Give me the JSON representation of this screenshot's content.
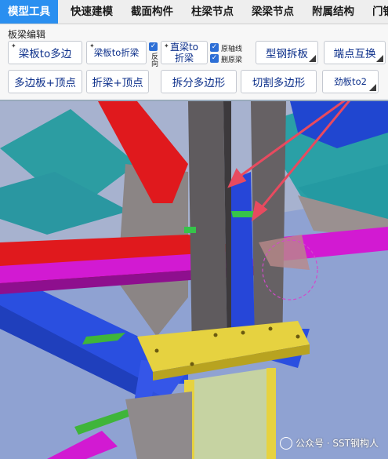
{
  "tabs": [
    {
      "label": "模型工具",
      "active": true
    },
    {
      "label": "快速建模",
      "active": false
    },
    {
      "label": "截面构件",
      "active": false
    },
    {
      "label": "柱梁节点",
      "active": false
    },
    {
      "label": "梁梁节点",
      "active": false
    },
    {
      "label": "附属结构",
      "active": false
    },
    {
      "label": "门钢",
      "active": false
    }
  ],
  "ribbon": {
    "group_label": "板梁编辑",
    "buttons": {
      "plate_to_polygon": "梁板to多边",
      "plate_to_folded": "梁板to折梁",
      "straight_line1": "直梁to",
      "straight_line2": "折梁",
      "section_steel_split": "型钢拆板",
      "end_swap": "端点互换",
      "polygon_vertex": "多边板+顶点",
      "folded_vertex": "折梁+顶点",
      "split_polygon": "拆分多边形",
      "cut_polygon": "切割多边形",
      "stiffener": "劲板to2"
    },
    "checkboxes": {
      "reverse": "反向",
      "original_axis": "原轴线",
      "delete_original": "删原梁"
    }
  },
  "watermark": "公众号 · SST钢构人",
  "colors": {
    "active_tab": "#2a8ff0",
    "button_text": "#0c2f8a",
    "red_beam": "#e0191d",
    "magenta_beam": "#d21ad2",
    "blue_beam": "#2a4fe0",
    "teal_plate": "#2a9ca0",
    "arrow": "#e84a5f"
  }
}
